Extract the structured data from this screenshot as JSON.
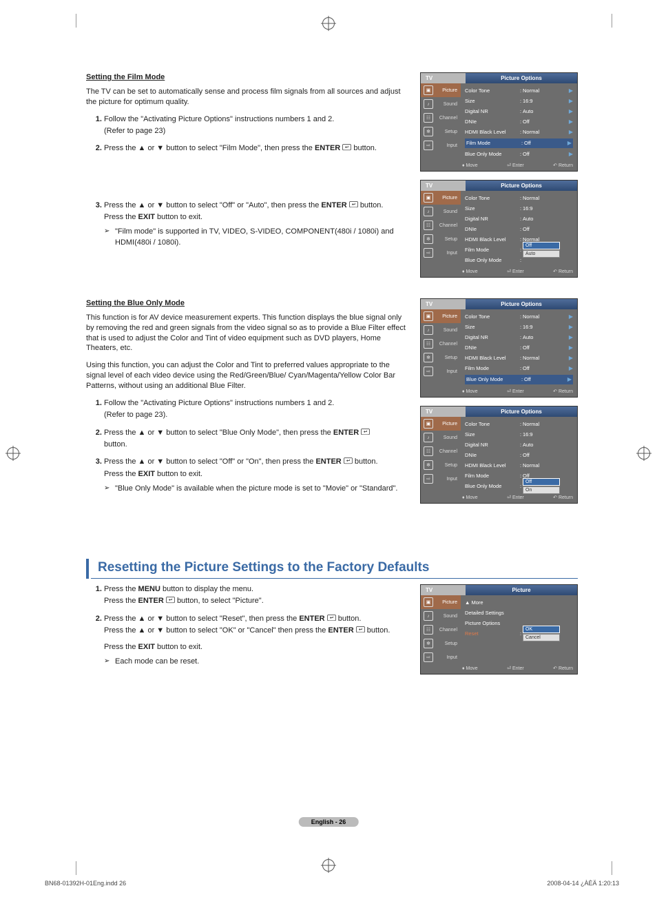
{
  "sections": {
    "film": {
      "heading": "Setting the Film Mode",
      "intro": "The TV can be set to automatically sense and process film signals from all sources and adjust the picture for optimum quality.",
      "step1a": "Follow the \"Activating Picture Options\" instructions numbers 1 and 2.",
      "step1b": "(Refer to page 23)",
      "step2_p1": "Press the ▲ or ▼ button to select \"Film Mode\", then press the ",
      "step2_enter": "ENTER",
      "step2_p2": " button.",
      "step3_p1": "Press the ▲ or ▼ button to select \"Off\" or \"Auto\", then press the ",
      "step3_enter": "ENTER",
      "step3_p2": " button.",
      "step3_exit_p1": "Press the ",
      "step3_exit_bold": "EXIT",
      "step3_exit_p2": " button to exit.",
      "note": "\"Film mode\" is supported in TV, VIDEO, S-VIDEO, COMPONENT(480i / 1080i) and HDMI(480i / 1080i)."
    },
    "blue": {
      "heading": "Setting the Blue Only Mode",
      "intro1": "This function is for AV device measurement experts. This function displays the blue signal only by removing the red and green signals from the video signal so as to provide a Blue Filter effect that is used to adjust the Color and Tint of video equipment such as DVD players, Home Theaters, etc.",
      "intro2": "Using this function, you can adjust the Color and Tint to preferred values appropriate to the signal level of each video device using the Red/Green/Blue/ Cyan/Magenta/Yellow Color Bar Patterns, without using an additional Blue Filter.",
      "step1a": "Follow the \"Activating Picture Options\" instructions numbers 1 and 2.",
      "step1b": "(Refer to page 23).",
      "step2_p1": "Press the ▲ or ▼ button to select \"Blue Only Mode\", then press the ",
      "step2_enter": "ENTER",
      "step2_p2": " button.",
      "step3_p1": "Press the ▲ or ▼ button to select \"Off\" or \"On\", then press the ",
      "step3_enter": "ENTER",
      "step3_p2": " button.",
      "step3_exit_p1": "Press the ",
      "step3_exit_bold": "EXIT",
      "step3_exit_p2": " button to exit.",
      "note": "\"Blue Only Mode\" is available when the picture mode is set to \"Movie\" or \"Standard\"."
    },
    "reset": {
      "title": "Resetting the Picture Settings to the Factory Defaults",
      "step1_p1": "Press the ",
      "step1_menu": "MENU",
      "step1_p2": " button to display the menu.",
      "step1b_p1": "Press the ",
      "step1b_enter": "ENTER",
      "step1b_p2": " button, to select \"Picture\".",
      "step2_p1": "Press the ▲ or ▼ button to select \"Reset\", then press the ",
      "step2_enter": "ENTER",
      "step2_p2": " button.",
      "step2b_p1": "Press the ▲ or ▼ button to select \"OK\" or \"Cancel\" then press the ",
      "step2b_enter": "ENTER",
      "step2b_p2": " button.",
      "exit_p1": "Press the ",
      "exit_bold": "EXIT",
      "exit_p2": " button to exit.",
      "note": "Each mode can be reset."
    }
  },
  "osd": {
    "tv": "TV",
    "po_title": "Picture Options",
    "pic_title": "Picture",
    "side": [
      "Picture",
      "Sound",
      "Channel",
      "Setup",
      "Input"
    ],
    "rows": {
      "color_tone": "Color Tone",
      "size": "Size",
      "digital_nr": "Digital NR",
      "dnie": "DNIe",
      "hdmi_black": "HDMI Black Level",
      "film_mode": "Film Mode",
      "blue_only": "Blue Only Mode"
    },
    "vals": {
      "normal": "Normal",
      "r169": "16:9",
      "auto": "Auto",
      "off": "Off",
      "on": "On"
    },
    "footer": {
      "move": "Move",
      "enter": "Enter",
      "return": "Return"
    },
    "reset_menu": {
      "more": "▲ More",
      "detailed": "Detailed Settings",
      "po": "Picture Options",
      "reset": "Reset",
      "ok": "OK",
      "cancel": "Cancel"
    }
  },
  "page_footer": "English - 26",
  "doc_meta_left": "BN68-01392H-01Eng.indd   26",
  "doc_meta_right": "2008-04-14   ¿ÀÈÄ 1:20:13"
}
